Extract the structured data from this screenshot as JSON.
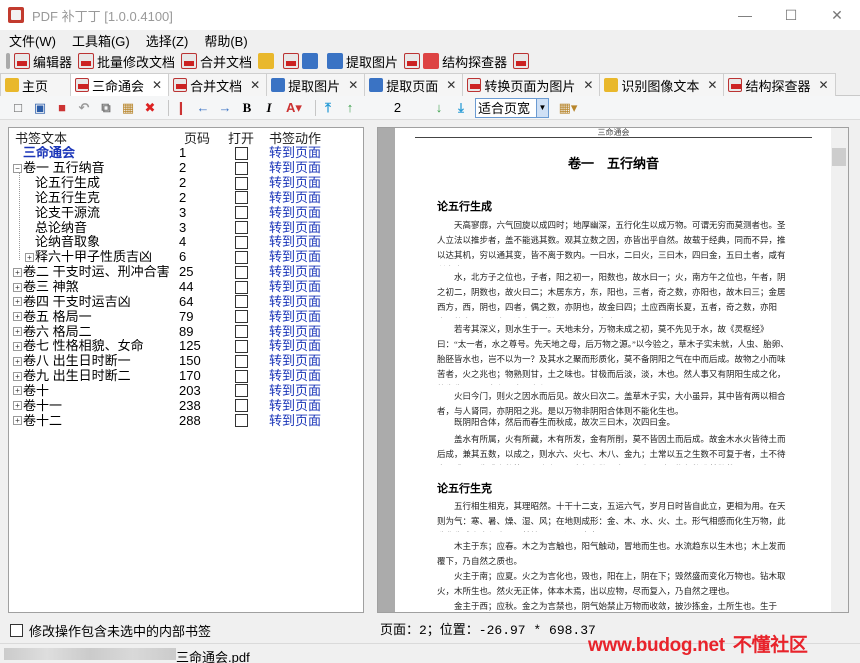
{
  "window": {
    "title": "PDF 补丁丁 [1.0.0.4100]"
  },
  "menu": [
    "文件(W)",
    "工具箱(G)",
    "选择(Z)",
    "帮助(B)"
  ],
  "toolbar": {
    "items": [
      "编辑器",
      "批量修改文档",
      "合并文档",
      "",
      "",
      "提取图片",
      "结构探查器",
      ""
    ]
  },
  "tabs": [
    {
      "label": "主页",
      "active": false,
      "closable": false
    },
    {
      "label": "三命通会",
      "active": true,
      "closable": true
    },
    {
      "label": "合并文档",
      "active": false,
      "closable": true
    },
    {
      "label": "提取图片",
      "active": false,
      "closable": true
    },
    {
      "label": "提取页面",
      "active": false,
      "closable": true
    },
    {
      "label": "转换页面为图片",
      "active": false,
      "closable": true
    },
    {
      "label": "识别图像文本",
      "active": false,
      "closable": true
    },
    {
      "label": "结构探查器",
      "active": false,
      "closable": true
    }
  ],
  "viewer_toolbar": {
    "page_number": "2",
    "zoom": "适合页宽"
  },
  "bookmark_tree": {
    "headers": {
      "text": "书签文本",
      "page": "页码",
      "open": "打开",
      "action": "书签动作"
    },
    "rows": [
      {
        "text": "三命通会",
        "page": "1",
        "action": "转到页面",
        "level": 0,
        "expander": "",
        "selected": true
      },
      {
        "text": "卷一 五行纳音",
        "page": "2",
        "action": "转到页面",
        "level": 0,
        "expander": "−",
        "selected": false
      },
      {
        "text": "论五行生成",
        "page": "2",
        "action": "转到页面",
        "level": 1,
        "expander": "",
        "selected": false
      },
      {
        "text": "论五行生克",
        "page": "2",
        "action": "转到页面",
        "level": 1,
        "expander": "",
        "selected": false
      },
      {
        "text": "论支干源流",
        "page": "3",
        "action": "转到页面",
        "level": 1,
        "expander": "",
        "selected": false
      },
      {
        "text": "总论纳音",
        "page": "3",
        "action": "转到页面",
        "level": 1,
        "expander": "",
        "selected": false
      },
      {
        "text": "论纳音取象",
        "page": "4",
        "action": "转到页面",
        "level": 1,
        "expander": "",
        "selected": false
      },
      {
        "text": "释六十甲子性质吉凶",
        "page": "6",
        "action": "转到页面",
        "level": 1,
        "expander": "+",
        "selected": false
      },
      {
        "text": "卷二 干支时运、刑冲合害",
        "page": "25",
        "action": "转到页面",
        "level": 0,
        "expander": "+",
        "selected": false
      },
      {
        "text": "卷三 神煞",
        "page": "44",
        "action": "转到页面",
        "level": 0,
        "expander": "+",
        "selected": false
      },
      {
        "text": "卷四 干支时运吉凶",
        "page": "64",
        "action": "转到页面",
        "level": 0,
        "expander": "+",
        "selected": false
      },
      {
        "text": "卷五 格局一",
        "page": "79",
        "action": "转到页面",
        "level": 0,
        "expander": "+",
        "selected": false
      },
      {
        "text": "卷六 格局二",
        "page": "89",
        "action": "转到页面",
        "level": 0,
        "expander": "+",
        "selected": false
      },
      {
        "text": "卷七 性格相貌、女命",
        "page": "125",
        "action": "转到页面",
        "level": 0,
        "expander": "+",
        "selected": false
      },
      {
        "text": "卷八 出生日时断一",
        "page": "150",
        "action": "转到页面",
        "level": 0,
        "expander": "+",
        "selected": false
      },
      {
        "text": "卷九 出生日时断二",
        "page": "170",
        "action": "转到页面",
        "level": 0,
        "expander": "+",
        "selected": false
      },
      {
        "text": "卷十",
        "page": "203",
        "action": "转到页面",
        "level": 0,
        "expander": "+",
        "selected": false
      },
      {
        "text": "卷十一",
        "page": "238",
        "action": "转到页面",
        "level": 0,
        "expander": "+",
        "selected": false
      },
      {
        "text": "卷十二",
        "page": "288",
        "action": "转到页面",
        "level": 0,
        "expander": "+",
        "selected": false
      }
    ]
  },
  "page_preview": {
    "header": "三命通会",
    "title": "卷一　五行纳音",
    "section1": "论五行生成",
    "para1": "天高寥廓，六气回旋以成四时；地厚幽深，五行化生以成万物。可谓无穷而莫测者也。圣人立法以推步者，盖不能逃其数。观其立数之因，亦皆出乎自然。故载于经典，同而不异，推以达其机，穷以通其变，皆不离于数内。一曰水，二曰火，三曰木，四曰金，五曰土者，咸有所自也。",
    "para2": "水，北方子之位也，子者，阳之初一，阳数也，故水曰一；火，南方午之位也，午者，阴之初二，阴数也，故火曰二；木居东方，东，阳也，三者，奇之数，亦阳也，故木曰三；金居西方，西，阴也，四者，偶之数，亦阴也，故金曰四；土应西南长夏，五者，奇之数，亦阳也，故土曰五。由是论之，则数以阴阳而配者也。",
    "para3": "若考其深义，则水生于一。天地未分，万物未成之初，莫不先见于水，故《灵枢经》曰：“太一者，水之尊号。先天地之母，后万物之源。”以今验之，草木子实未就，人虫、胎卵、胎胚皆水也，岂不以为一？及其水之聚而形质化，莫不备阴阳之气在中而后成。故物之小而味苦者，火之兆也；物熟则甘，土之味也。甘极而后淡，淡，木也。然人事又有阴阳生成之化，故先生二耳，名肾属水，右肾属火。",
    "para4": "火曰今门，则火之因水而后见。故火曰次二。盖草木子实，大小虽异，其中皆有两以相合者，与人肾同，亦阴阳之兆。是以万物非阴阳合体则不能化生也。",
    "para5": "既阴阳合体，然后而春生而秋成，故次三曰木，次四曰金。",
    "para6": "盖水有所属，火有所藏，木有所发，金有所削，莫不皆因土而后成。故金木水火皆待土而后成，兼其五数，以成之，则水六、火七、木八、金九；土常以五之生数不可复于者，土不待十以成。是生成之数皆五以合之。明大衍之数，由是以立，则万物包数谁其数哉？",
    "section2": "论五行生克",
    "para7": "五行相生相克，其理昭然。十干十二支，五运六气，岁月日时皆自此立，更相为用。在天则为气：寒、暑、燥、湿、风；在地则成形：金、木、水、火、土。形气相感而化生万物，此造化生成之大纪也。原其妙用，可谓无穷矣。",
    "para8": "木主于东；应春。木之为言触也，阳气触动，冒地而生也。水流趋东以生木也；木上发而覆下，乃自然之质也。",
    "para9": "火主于南；应夏。火之为言化也，毁也，阳在上，阴在下；毁然盛而变化万物也。钻木取火，木所生也。然火无正体，体本木焉，出以应物，尽而复入，乃自然之理也。",
    "para10": "金主于西；应秋。金之为言禁也，阴气始禁止万物而收敛，披沙拣金，土所生也。生于"
  },
  "status": {
    "page_label": "页面：2；位置：-26.97 * 698.37",
    "modify_option": "修改操作包含未选中的内部书签",
    "file": "三命通会.pdf",
    "watermark_url": "www.budog.net",
    "watermark_cn": "不懂社区"
  }
}
